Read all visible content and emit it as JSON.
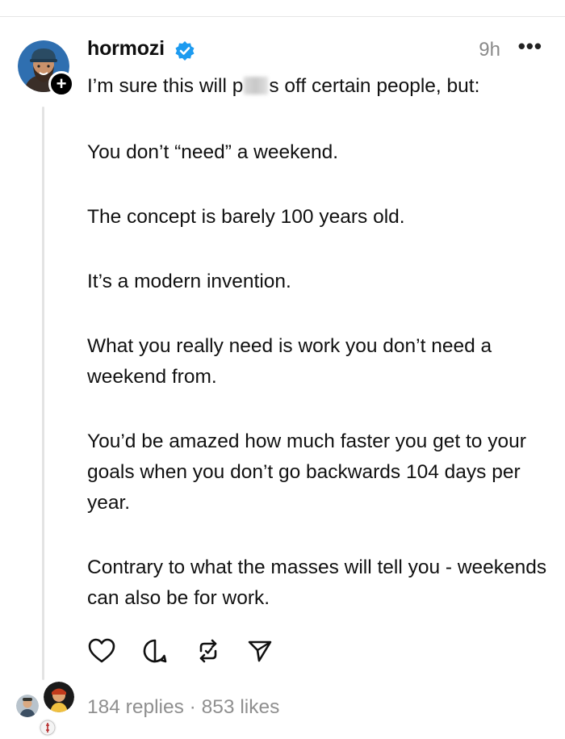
{
  "post": {
    "username": "hormozi",
    "timestamp": "9h",
    "more_label": "•••",
    "follow_label": "+",
    "blurred_word_prefix": "I’m sure this will p",
    "blurred_word_suffix": "s off certain people, but:",
    "paragraphs": [
      "You don’t “need” a weekend.",
      "The concept is barely 100 years old.",
      "It’s a modern invention.",
      "What you really need is work you don’t need a weekend from.",
      "You’d be amazed how much faster you get to your goals when you don’t go backwards 104 days per year.",
      "Contrary to what the masses will tell you - weekends can also be for work."
    ]
  },
  "actions": {
    "like_icon": "heart-icon",
    "comment_icon": "comment-icon",
    "repost_icon": "repost-icon",
    "share_icon": "send-icon"
  },
  "stats": {
    "text": "184 replies · 853 likes"
  },
  "colors": {
    "verified": "#1d9bf0",
    "muted": "#8f8f8f",
    "thread_line": "#e3e3e3"
  }
}
